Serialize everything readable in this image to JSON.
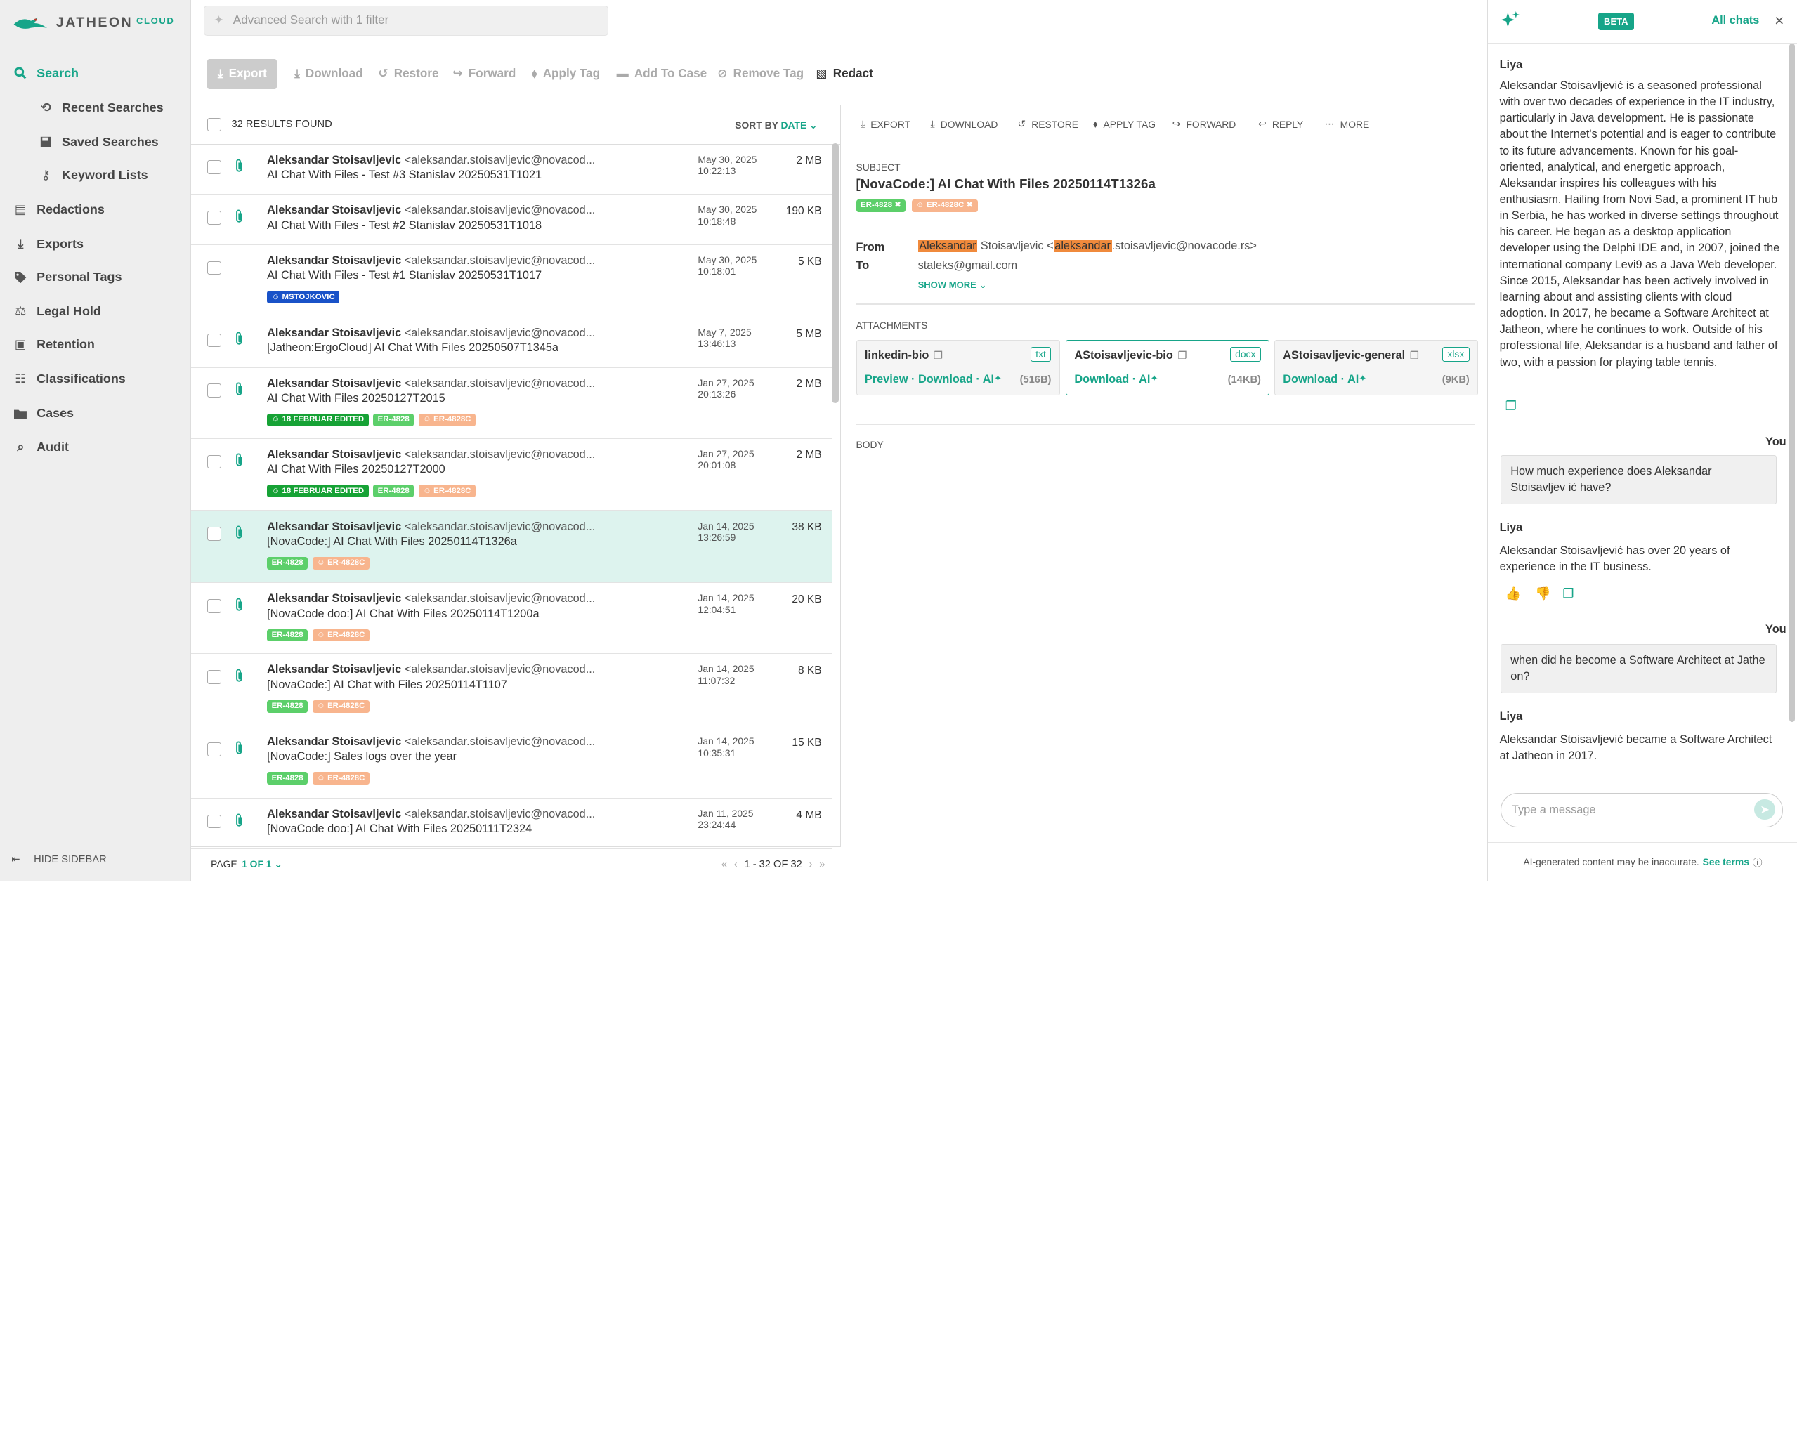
{
  "app": {
    "brand": "JATHEON",
    "brand_suffix": "CLOUD",
    "accent": "#17a589"
  },
  "search": {
    "placeholder": "Advanced Search with 1 filter"
  },
  "sidebar": {
    "items": [
      {
        "label": "Search",
        "icon": "search-icon"
      },
      {
        "label": "Recent Searches",
        "icon": "history-icon"
      },
      {
        "label": "Saved Searches",
        "icon": "save-icon"
      },
      {
        "label": "Keyword Lists",
        "icon": "key-icon"
      },
      {
        "label": "Redactions",
        "icon": "redaction-icon"
      },
      {
        "label": "Exports",
        "icon": "download-icon"
      },
      {
        "label": "Personal Tags",
        "icon": "tag-icon"
      },
      {
        "label": "Legal Hold",
        "icon": "scale-icon"
      },
      {
        "label": "Retention",
        "icon": "retention-icon"
      },
      {
        "label": "Classifications",
        "icon": "classification-icon"
      },
      {
        "label": "Cases",
        "icon": "folder-icon"
      },
      {
        "label": "Audit",
        "icon": "audit-icon"
      }
    ],
    "hide_label": "HIDE SIDEBAR"
  },
  "toolbar": {
    "export": "Export",
    "download": "Download",
    "restore": "Restore",
    "forward": "Forward",
    "apply_tag": "Apply Tag",
    "add_to_case": "Add To Case",
    "remove_tag": "Remove Tag",
    "redact": "Redact"
  },
  "list": {
    "count": "32 RESULTS FOUND",
    "sort_label": "SORT BY",
    "sort_value": "DATE",
    "rows": [
      {
        "from": "Aleksandar Stoisavljevic",
        "email": "<aleksandar.stoisavljevic@novacod...",
        "subject": "AI Chat With Files - Test #3 Stanislav 20250531T1021",
        "date": "May 30, 2025",
        "time": "10:22:13",
        "size": "2 MB",
        "tags": []
      },
      {
        "from": "Aleksandar Stoisavljevic",
        "email": "<aleksandar.stoisavljevic@novacod...",
        "subject": "AI Chat With Files - Test #2 Stanislav 20250531T1018",
        "date": "May 30, 2025",
        "time": "10:18:48",
        "size": "190 KB",
        "tags": []
      },
      {
        "from": "Aleksandar Stoisavljevic",
        "email": "<aleksandar.stoisavljevic@novacod...",
        "subject": "AI Chat With Files - Test #1 Stanislav 20250531T1017",
        "date": "May 30, 2025",
        "time": "10:18:01",
        "size": "5 KB",
        "tags": [
          "MSTOJKOVIC"
        ]
      },
      {
        "from": "Aleksandar Stoisavljevic",
        "email": "<aleksandar.stoisavljevic@novacod...",
        "subject": "[Jatheon:ErgoCloud] AI Chat With Files 20250507T1345a",
        "date": "May 7, 2025",
        "time": "13:46:13",
        "size": "5 MB",
        "tags": []
      },
      {
        "from": "Aleksandar Stoisavljevic",
        "email": "<aleksandar.stoisavljevic@novacod...",
        "subject": "AI Chat With Files 20250127T2015",
        "date": "Jan 27, 2025",
        "time": "20:13:26",
        "size": "2 MB",
        "tags": [
          "18 FEBRUAR EDITED",
          "ER-4828",
          "ER-4828C"
        ]
      },
      {
        "from": "Aleksandar Stoisavljevic",
        "email": "<aleksandar.stoisavljevic@novacod...",
        "subject": "AI Chat With Files 20250127T2000",
        "date": "Jan 27, 2025",
        "time": "20:01:08",
        "size": "2 MB",
        "tags": [
          "18 FEBRUAR EDITED",
          "ER-4828",
          "ER-4828C"
        ]
      },
      {
        "from": "Aleksandar Stoisavljevic",
        "email": "<aleksandar.stoisavljevic@novacod...",
        "subject": "[NovaCode:] AI Chat With Files 20250114T1326a",
        "date": "Jan 14, 2025",
        "time": "13:26:59",
        "size": "38 KB",
        "tags": [
          "ER-4828",
          "ER-4828C"
        ]
      },
      {
        "from": "Aleksandar Stoisavljevic",
        "email": "<aleksandar.stoisavljevic@novacod...",
        "subject": "[NovaCode doo:] AI Chat With Files 20250114T1200a",
        "date": "Jan 14, 2025",
        "time": "12:04:51",
        "size": "20 KB",
        "tags": [
          "ER-4828",
          "ER-4828C"
        ]
      },
      {
        "from": "Aleksandar Stoisavljevic",
        "email": "<aleksandar.stoisavljevic@novacod...",
        "subject": "[NovaCode:] AI Chat with Files 20250114T1107",
        "date": "Jan 14, 2025",
        "time": "11:07:32",
        "size": "8 KB",
        "tags": [
          "ER-4828",
          "ER-4828C"
        ]
      },
      {
        "from": "Aleksandar Stoisavljevic",
        "email": "<aleksandar.stoisavljevic@novacod...",
        "subject": "[NovaCode:] Sales logs over the year",
        "date": "Jan 14, 2025",
        "time": "10:35:31",
        "size": "15 KB",
        "tags": [
          "ER-4828",
          "ER-4828C"
        ]
      },
      {
        "from": "Aleksandar Stoisavljevic",
        "email": "<aleksandar.stoisavljevic@novacod...",
        "subject": "[NovaCode doo:] AI Chat With Files 20250111T2324",
        "date": "Jan 11, 2025",
        "time": "23:24:44",
        "size": "4 MB",
        "tags": []
      }
    ]
  },
  "pager": {
    "label": "PAGE",
    "value": "1 OF 1",
    "range": "1 - 32 OF 32"
  },
  "detail": {
    "actions": {
      "export": "EXPORT",
      "download": "DOWNLOAD",
      "restore": "RESTORE",
      "apply_tag": "APPLY TAG",
      "forward": "FORWARD",
      "reply": "REPLY",
      "more": "MORE"
    },
    "subject_label": "SUBJECT",
    "subject": "[NovaCode:] AI Chat With Files 20250114T1326a",
    "tags": [
      "ER-4828",
      "ER-4828C"
    ],
    "from_label": "From",
    "from_hl1": "Aleksandar",
    "from_mid": " Stoisavljevic <",
    "from_hl2": "aleksandar",
    "from_end": ".stoisavljevic@novacode.rs>",
    "to_label": "To",
    "to": "staleks@gmail.com",
    "show_more": "SHOW MORE",
    "attachments_label": "ATTACHMENTS",
    "attachments": [
      {
        "name": "linkedin-bio",
        "ext": "txt",
        "actions": "Preview · Download · AI",
        "size": "(516B)"
      },
      {
        "name": "AStoisavljevic-bio",
        "ext": "docx",
        "actions": "Download · AI",
        "size": "(14KB)"
      },
      {
        "name": "AStoisavljevic-general",
        "ext": "xlsx",
        "actions": "Download · AI",
        "size": "(9KB)"
      }
    ],
    "body_label": "BODY"
  },
  "chat": {
    "beta": "BETA",
    "all_chats": "All chats",
    "bot": "Liya",
    "you": "You",
    "m1": "Aleksandar Stoisavljević is a seasoned professional with over two decades of experience in the IT industry, particularly in Java development. He is passionate about the Internet's potential and is eager to contribute to its future advancements. Known for his goal-oriented, analytical, and energetic approach, Aleksandar inspires his colleagues with his enthusiasm. Hailing from Novi Sad, a prominent IT hub in Serbia, he has worked in diverse settings throughout his career. He began as a desktop application developer using the Delphi IDE and, in 2007, joined the international company Levi9 as a Java Web developer. Since 2015, Aleksandar has been actively involved in learning about and assisting clients with cloud adoption. In 2017, he became a Software Architect at Jatheon, where he continues to work. Outside of his professional life, Aleksandar is a husband and father of two, with a passion for playing table tennis.",
    "q1": "How much experience does Aleksandar Stoisavljev ić have?",
    "m2": "Aleksandar Stoisavljević has over 20 years of experience in the IT business.",
    "q2": "when did he become a Software Architect at Jathe on?",
    "m3": "Aleksandar Stoisavljević became a Software Architect at Jatheon in 2017.",
    "input_placeholder": "Type a message",
    "footer": "AI-generated content may be inaccurate.",
    "footer_link": "See terms"
  }
}
